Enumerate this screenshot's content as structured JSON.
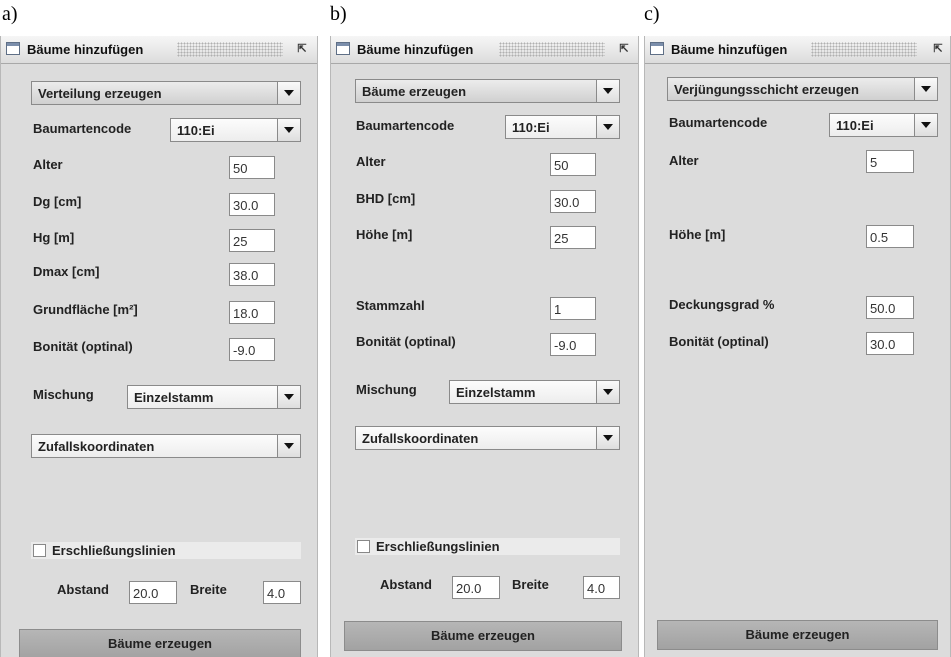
{
  "panels": {
    "a": {
      "label": "a)",
      "window_title": "Bäume hinzufügen",
      "mode": "Verteilung erzeugen",
      "species_label": "Baumartencode",
      "species_value": "110:Ei",
      "fields": [
        {
          "label": "Alter",
          "value": "50"
        },
        {
          "label": "Dg [cm]",
          "value": "30.0"
        },
        {
          "label": "Hg [m]",
          "value": "25"
        },
        {
          "label": "Dmax [cm]",
          "value": "38.0"
        },
        {
          "label": "Grundfläche [m²]",
          "value": "18.0"
        },
        {
          "label": "Bonität (optinal)",
          "value": "-9.0"
        }
      ],
      "mixing_label": "Mischung",
      "mixing_value": "Einzelstamm",
      "coords_value": "Zufallskoordinaten",
      "checkbox_label": "Erschließungslinien",
      "spacing_label": "Abstand",
      "spacing_value": "20.0",
      "width_label": "Breite",
      "width_value": "4.0",
      "action_button": "Bäume erzeugen"
    },
    "b": {
      "label": "b)",
      "window_title": "Bäume hinzufügen",
      "mode": "Bäume erzeugen",
      "species_label": "Baumartencode",
      "species_value": "110:Ei",
      "fields": [
        {
          "label": "Alter",
          "value": "50"
        },
        {
          "label": "BHD [cm]",
          "value": "30.0"
        },
        {
          "label": "Höhe [m]",
          "value": "25"
        },
        {
          "label": "Stammzahl",
          "value": "1"
        },
        {
          "label": "Bonität (optinal)",
          "value": "-9.0"
        }
      ],
      "mixing_label": "Mischung",
      "mixing_value": "Einzelstamm",
      "coords_value": "Zufallskoordinaten",
      "checkbox_label": "Erschließungslinien",
      "spacing_label": "Abstand",
      "spacing_value": "20.0",
      "width_label": "Breite",
      "width_value": "4.0",
      "action_button": "Bäume erzeugen"
    },
    "c": {
      "label": "c)",
      "window_title": "Bäume hinzufügen",
      "mode": "Verjüngungsschicht erzeugen",
      "species_label": "Baumartencode",
      "species_value": "110:Ei",
      "fields": [
        {
          "label": "Alter",
          "value": "5"
        },
        {
          "label": "Höhe [m]",
          "value": "0.5"
        },
        {
          "label": "Deckungsgrad %",
          "value": "50.0"
        },
        {
          "label": "Bonität (optinal)",
          "value": "30.0"
        }
      ],
      "action_button": "Bäume erzeugen"
    }
  }
}
